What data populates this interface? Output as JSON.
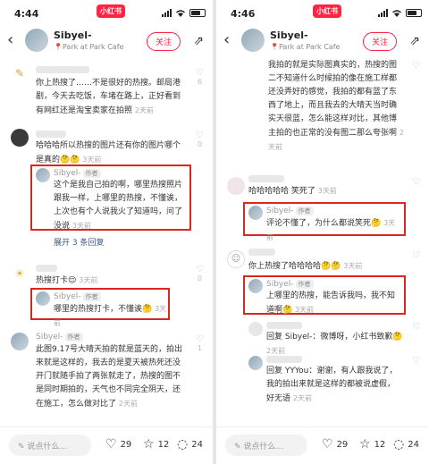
{
  "screens": {
    "left": {
      "time": "4:44",
      "app_badge": "小红书",
      "header": {
        "name": "Sibyel-",
        "location": "Park at Park Cafe",
        "follow": "关注"
      },
      "c1": {
        "text": "你上热搜了……不是很好的热搜。邮局港剧，今天去吃饭，车堵在路上，正好看到有网红还是淘宝卖家在拍照",
        "time": "2天前",
        "likes": "6"
      },
      "c2": {
        "text": "哈哈哈所以热搜的图片还有你的图片哪个是真的🤔🤔",
        "time": "3天前",
        "likes": "0"
      },
      "r1": {
        "name": "Sibyel-",
        "author": "作者",
        "text": "这个是我自己拍的啊，哪里热搜照片跟我一样，上哪里的热搜，不懂诶，上次也有个人说我火了知道吗，问了没说",
        "time": "3天前"
      },
      "expand": "展开 3 条回复",
      "c3": {
        "text": "热搜打卡😌",
        "time": "3天前",
        "likes": "0"
      },
      "r2": {
        "name": "Sibyel-",
        "author": "作者",
        "text": "哪里的热搜打卡，不懂诶🤔",
        "time": "3天前"
      },
      "r3": {
        "name": "Sibyel-",
        "author": "作者",
        "text": "此图9.17号大晴天拍的就是蓝天的，拍出来就是这样的，我去的是夏天被热死还没开门就随手拍了两张就走了，热搜的图不是同时期拍的，天气也不同完全阴天，还在施工，怎么做对比了",
        "time": "2天前",
        "likes": "1"
      },
      "bottom": {
        "input": "说点什么…",
        "likes": "29",
        "stars": "12",
        "comments": "24"
      }
    },
    "right": {
      "time": "4:46",
      "app_badge": "小红书",
      "header": {
        "name": "Sibyel-",
        "location": "Park at Park Cafe",
        "follow": "关注"
      },
      "r0": {
        "name": "Sibyel-",
        "author": "作者",
        "text": "我拍的就是实际图真实的，热搜的图二不知道什么时候拍的像在施工样都还没弄好的感觉，我拍的都有蓝了东西了地上，而且我去的大晴天当时确实天很蓝，怎么能这样对比，其他博主拍的也正常的没有图二那么夸张啊",
        "time": "2天前"
      },
      "c1": {
        "text": "哈哈哈哈哈 笑死了",
        "time": "3天前"
      },
      "r1": {
        "name": "Sibyel-",
        "author": "作者",
        "text": "评论不懂了，为什么都说笑死🤔",
        "time": "3天前"
      },
      "c2": {
        "text": "你上热搜了哈哈哈哈🤔🤔",
        "time": "3天前"
      },
      "r2": {
        "name": "Sibyel-",
        "author": "作者",
        "text": "上哪里的热搜，能告诉我吗，我不知道啊🤔",
        "time": "3天前"
      },
      "r3": {
        "text": "回复 Sibyel-：微博呀，小红书致歉🤔",
        "time": "2天前"
      },
      "r4": {
        "text": "回复 YYYou：谢谢，有人跟我说了，我的拍出来就是这样的都被说虚假，好无语",
        "time": "2天前"
      },
      "bottom": {
        "input": "说点什么…",
        "likes": "29",
        "stars": "12",
        "comments": "24"
      }
    }
  },
  "colors": {
    "accent": "#ff2442",
    "highlight_box": "#d8281f",
    "link": "#3b5b8f"
  }
}
